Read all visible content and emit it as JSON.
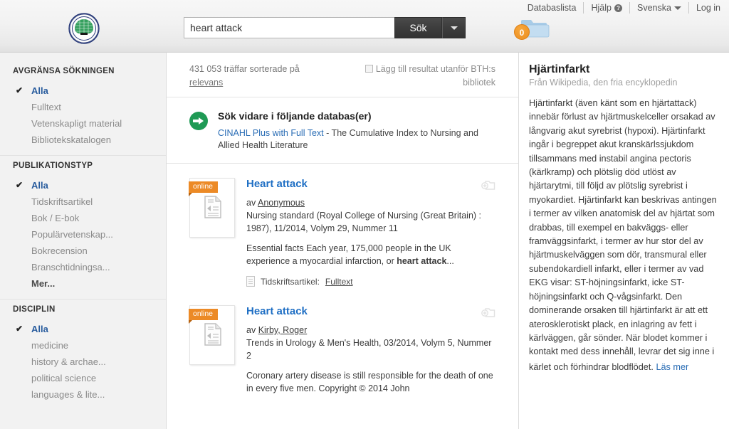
{
  "header": {
    "topnav": [
      {
        "label": "Databaslista",
        "icon": null
      },
      {
        "label": "Hjälp",
        "icon": "help-badge-icon"
      },
      {
        "label": "Svenska",
        "icon": "chevron-down-icon"
      },
      {
        "label": "Log in",
        "icon": null
      }
    ],
    "help_badge_glyph": "?",
    "logo_name": "bth-library-logo",
    "search": {
      "value": "heart attack",
      "placeholder": "",
      "button_label": "Sök"
    },
    "folder": {
      "count": "0",
      "name": "folder-icon"
    }
  },
  "sidebar": {
    "groups": [
      {
        "title": "AVGRÄNSA SÖKNINGEN",
        "items": [
          {
            "label": "Alla",
            "selected": true
          },
          {
            "label": "Fulltext",
            "selected": false
          },
          {
            "label": "Vetenskapligt material",
            "selected": false
          },
          {
            "label": "Bibliotekskatalogen",
            "selected": false
          }
        ]
      },
      {
        "title": "PUBLIKATIONSTYP",
        "items": [
          {
            "label": "Alla",
            "selected": true
          },
          {
            "label": "Tidskriftsartikel",
            "selected": false
          },
          {
            "label": "Bok / E-bok",
            "selected": false
          },
          {
            "label": "Populärvetenskap...",
            "selected": false
          },
          {
            "label": "Bokrecension",
            "selected": false
          },
          {
            "label": "Branschtidningsa...",
            "selected": false
          },
          {
            "label": "Mer...",
            "selected": false,
            "more": true
          }
        ]
      },
      {
        "title": "DISCIPLIN",
        "items": [
          {
            "label": "Alla",
            "selected": true
          },
          {
            "label": "medicine",
            "selected": false
          },
          {
            "label": "history & archae...",
            "selected": false
          },
          {
            "label": "political science",
            "selected": false
          },
          {
            "label": "languages & lite...",
            "selected": false
          }
        ]
      }
    ],
    "check_glyph": "✔"
  },
  "results_header": {
    "count_prefix": "431 053 träffar sorterade på",
    "sort_link": "relevans",
    "outside_option": "Lägg till resultat utanför BTH:s bibliotek"
  },
  "db_suggest": {
    "title": "Sök vidare i följande databas(er)",
    "link": "CINAHL Plus with Full Text",
    "desc": " - The Cumulative Index to Nursing and Allied Health Literature"
  },
  "results": [
    {
      "ribbon": "online",
      "title": "Heart attack",
      "author_prefix": "av ",
      "author": "Anonymous",
      "source": "Nursing standard (Royal College of Nursing (Great Britain) : 1987), 11/2014, Volym 29, Nummer 11",
      "snippet_pre": "Essential facts Each year, 175,000 people in the UK experience a myocardial infarction, or ",
      "snippet_bold": "heart attack",
      "snippet_post": "...",
      "format_label": "Tidskriftsartikel:",
      "format_link": "Fulltext"
    },
    {
      "ribbon": "online",
      "title": "Heart attack",
      "author_prefix": "av ",
      "author": "Kirby, Roger",
      "source": "Trends in Urology & Men's Health, 03/2014, Volym 5, Nummer 2",
      "snippet_pre": "Coronary artery disease is still responsible for the death of one in every five men. Copyright © 2014 John",
      "snippet_bold": "",
      "snippet_post": "",
      "format_label": "",
      "format_link": ""
    }
  ],
  "infopanel": {
    "title": "Hjärtinfarkt",
    "subtitle": "Från Wikipedia, den fria encyklopedin",
    "body": "Hjärtinfarkt (även känt som en hjärtattack) innebär förlust av hjärtmuskelceller orsakad av långvarig akut syrebrist (hypoxi). Hjärtinfarkt ingår i begreppet akut kranskärlssjukdom tillsammans med instabil angina pectoris (kärlkramp) och plötslig död utlöst av hjärtarytmi, till följd av plötslig syrebrist i myokardiet. Hjärtinfarkt kan beskrivas antingen i termer av vilken anatomisk del av hjärtat som drabbas, till exempel en bakväggs- eller framväggsinfarkt, i termer av hur stor del av hjärtmuskelväggen som dör, transmural eller subendokardiell infarkt, eller i termer av vad EKG visar: ST-höjningsinfarkt, icke ST-höjningsinfarkt och Q-vågsinfarkt. Den dominerande orsaken till hjärtinfarkt är att ett aterosklerotiskt plack, en inlagring av fett i kärlväggen, går sönder. När blodet kommer i kontakt med dess innehåll, levrar det sig inne i kärlet och förhindrar blodflödet.",
    "more_link": "Läs mer"
  },
  "colors": {
    "accent_blue": "#1f6fc4",
    "link_blue": "#2a6db5",
    "orange": "#ec8a26",
    "green": "#1f9a55",
    "selected_facet": "#2a5d9e"
  }
}
